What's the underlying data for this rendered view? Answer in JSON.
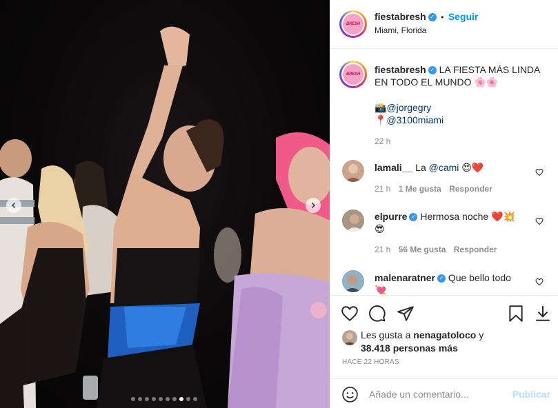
{
  "post": {
    "username": "fiestabresh",
    "follow_separator": "•",
    "follow_label": "Seguir",
    "location": "Miami, Florida",
    "avatar_text": "BRESH",
    "verified_mark": "✓"
  },
  "caption": {
    "username": "fiestabresh",
    "line1": "LA FIESTA MÁS LINDA",
    "line2": "EN TODO EL MUNDO",
    "emojis": "🌸🌸",
    "credit_icon": "📸",
    "credit_handle": "@jorgegry",
    "place_icon": "📍",
    "place_handle": "@3100miami",
    "age": "22 h"
  },
  "comments": [
    {
      "username": "lamali__",
      "text_prefix": "La ",
      "mention": "@cami",
      "emojis": "😍❤️",
      "age": "21 h",
      "likes": "1 Me gusta",
      "reply": "Responder",
      "verified": false,
      "avatar_color": "#c9a48a"
    },
    {
      "username": "elpurre",
      "text": "Hermosa noche",
      "emojis": "❤️💥",
      "emoji_line2": "😎",
      "age": "21 h",
      "likes": "56 Me gusta",
      "reply": "Responder",
      "verified": true,
      "avatar_color": "#8a7a6c"
    },
    {
      "username": "malenaratner",
      "text": "Que bello todo",
      "emoji_line2": "💘",
      "verified": true,
      "avatar_color": "#7c9bb0"
    }
  ],
  "likes": {
    "prefix": "Les gusta a",
    "user": "nenagatoloco",
    "joiner": "y",
    "count_text": "38.418 personas más"
  },
  "timestamp": "HACE 22 HORAS",
  "add_comment": {
    "placeholder": "Añade un comentario...",
    "publish": "Publicar"
  },
  "carousel": {
    "total": 10,
    "active_index": 7
  },
  "colors": {
    "accent": "#0095f6",
    "text": "#262626",
    "muted": "#8e8e8e",
    "border": "#efefef"
  }
}
